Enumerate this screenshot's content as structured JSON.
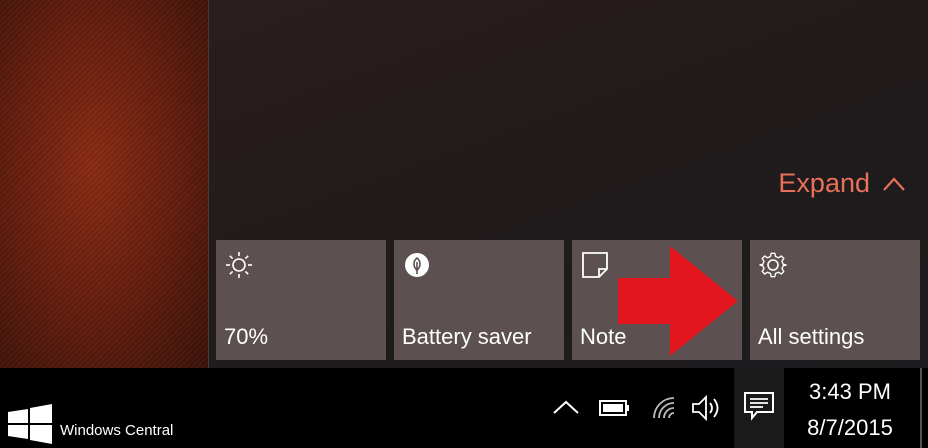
{
  "action_center": {
    "expand_label": "Expand",
    "tiles": [
      {
        "label": "70%",
        "icon": "sun-icon"
      },
      {
        "label": "Battery saver",
        "icon": "leaf-icon"
      },
      {
        "label": "Note",
        "icon": "note-icon"
      },
      {
        "label": "All settings",
        "icon": "gear-icon"
      }
    ]
  },
  "taskbar": {
    "brand": "Windows Central",
    "clock": {
      "time": "3:43 PM",
      "date": "8/7/2015"
    }
  },
  "colors": {
    "accent": "#e8705a",
    "tile_bg": "#5c5050",
    "annotation_arrow": "#e3161f",
    "taskbar_bg": "#000000"
  }
}
